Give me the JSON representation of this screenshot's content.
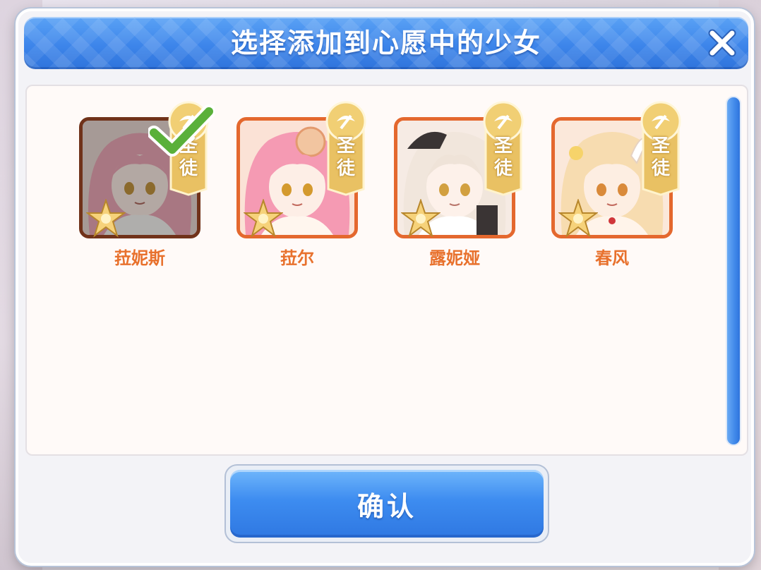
{
  "dialog": {
    "title": "选择添加到心愿中的少女",
    "close_icon": "close-x-icon"
  },
  "characters": [
    {
      "name": "菈妮斯",
      "badge_line1": "圣",
      "badge_line2": "徒",
      "selected": true,
      "hair_color": "#f3a3b4"
    },
    {
      "name": "菈尔",
      "badge_line1": "圣",
      "badge_line2": "徒",
      "selected": false,
      "hair_color": "#f59ab3"
    },
    {
      "name": "露妮娅",
      "badge_line1": "圣",
      "badge_line2": "徒",
      "selected": false,
      "hair_color": "#f1e6dc"
    },
    {
      "name": "春风",
      "badge_line1": "圣",
      "badge_line2": "徒",
      "selected": false,
      "hair_color": "#f7dcb0"
    }
  ],
  "confirm_button": {
    "label": "确认"
  },
  "colors": {
    "title_bar": "#3d85ea",
    "name_text": "#e8712d",
    "frame_border": "#e4682e",
    "badge_gold": "#e9c163",
    "check_green": "#5ab03a"
  }
}
